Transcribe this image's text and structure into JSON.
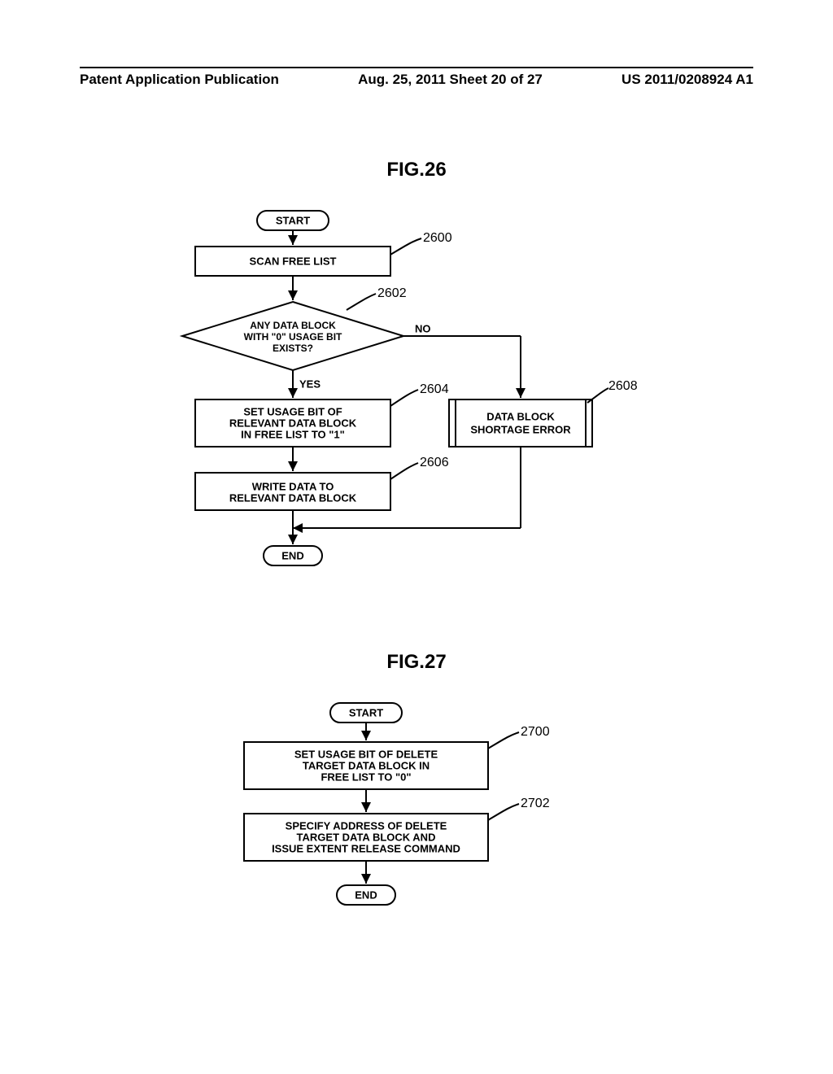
{
  "header": {
    "left": "Patent Application Publication",
    "mid": "Aug. 25, 2011  Sheet 20 of 27",
    "right": "US 2011/0208924 A1"
  },
  "fig26": {
    "title": "FIG.26",
    "start": "START",
    "end": "END",
    "b2600": "SCAN FREE LIST",
    "d2602_1": "ANY DATA BLOCK",
    "d2602_2": "WITH \"0\" USAGE BIT",
    "d2602_3": "EXISTS?",
    "b2604_1": "SET USAGE BIT OF",
    "b2604_2": "RELEVANT DATA BLOCK",
    "b2604_3": "IN FREE LIST TO \"1\"",
    "b2606_1": "WRITE DATA TO",
    "b2606_2": "RELEVANT DATA BLOCK",
    "b2608_1": "DATA BLOCK",
    "b2608_2": "SHORTAGE ERROR",
    "yes": "YES",
    "no": "NO",
    "r2600": "2600",
    "r2602": "2602",
    "r2604": "2604",
    "r2608": "2608",
    "r2606": "2606"
  },
  "fig27": {
    "title": "FIG.27",
    "start": "START",
    "end": "END",
    "b2700_1": "SET USAGE BIT OF DELETE",
    "b2700_2": "TARGET DATA BLOCK IN",
    "b2700_3": "FREE LIST TO \"0\"",
    "b2702_1": "SPECIFY ADDRESS OF DELETE",
    "b2702_2": "TARGET DATA BLOCK AND",
    "b2702_3": "ISSUE EXTENT RELEASE COMMAND",
    "r2700": "2700",
    "r2702": "2702"
  }
}
